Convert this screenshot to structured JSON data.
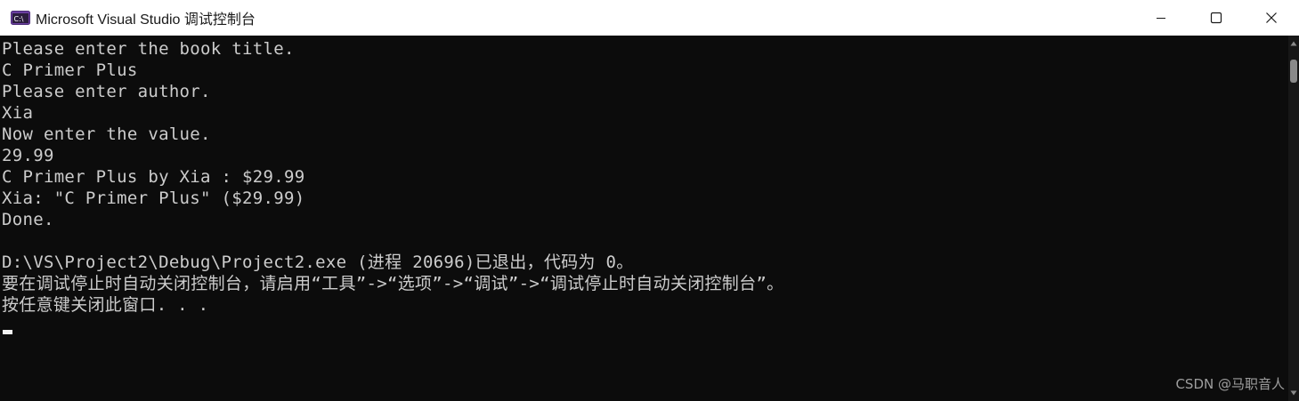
{
  "window": {
    "title": "Microsoft Visual Studio 调试控制台",
    "icon": "visual-studio-console-icon",
    "controls": {
      "minimize": "minimize-icon",
      "maximize": "maximize-icon",
      "close": "close-icon"
    }
  },
  "console": {
    "lines": [
      "Please enter the book title.",
      "C Primer Plus",
      "Please enter author.",
      "Xia",
      "Now enter the value.",
      "29.99",
      "C Primer Plus by Xia : $29.99",
      "Xia: \"C Primer Plus\" ($29.99)",
      "Done.",
      "",
      "D:\\VS\\Project2\\Debug\\Project2.exe (进程 20696)已退出，代码为 0。",
      "要在调试停止时自动关闭控制台，请启用“工具”->“选项”->“调试”->“调试停止时自动关闭控制台”。",
      "按任意键关闭此窗口. . ."
    ]
  },
  "watermark": "CSDN @马职音人",
  "colors": {
    "console_background": "#0c0c0c",
    "console_text": "#cccccc",
    "titlebar_background": "#ffffff"
  }
}
